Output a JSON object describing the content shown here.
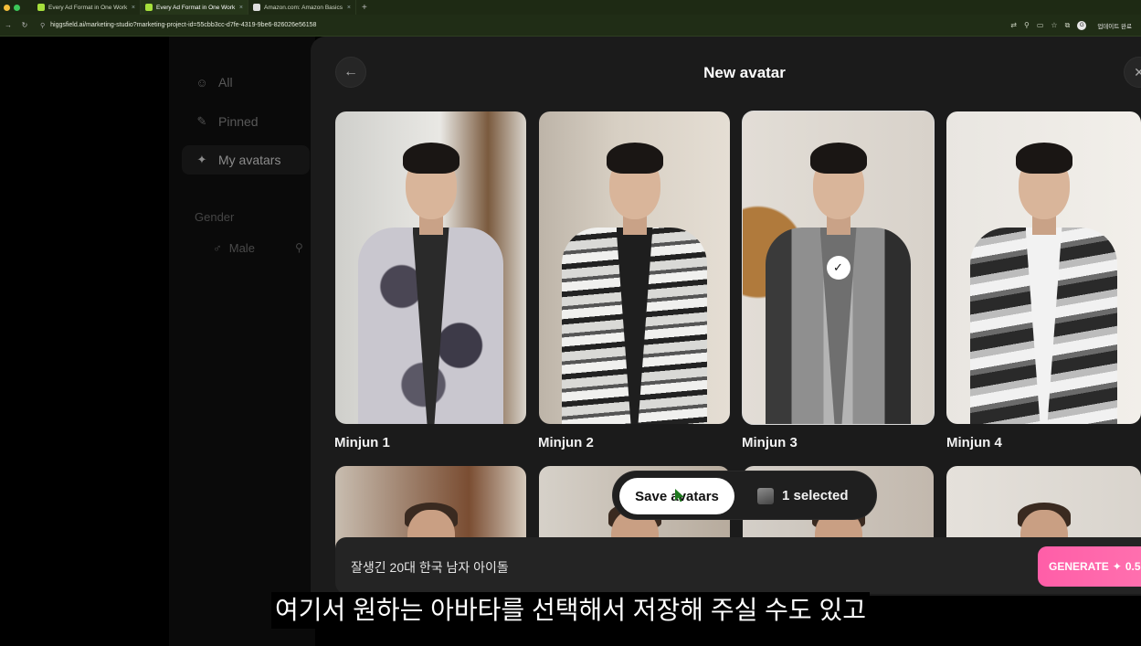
{
  "browser": {
    "tabs": [
      {
        "title": "Every Ad Format in One Work",
        "active": false
      },
      {
        "title": "Every Ad Format in One Work",
        "active": true
      },
      {
        "title": "Amazon.com: Amazon Basics",
        "active": false
      }
    ],
    "new_tab": "+",
    "url": "higgsfield.ai/marketing-studio?marketing-project-id=55cbb3cc-d7fe-4319-9be6-826026e56158",
    "update_label": "업데이트 완료",
    "profile_initial": "G"
  },
  "sidebar": {
    "items": [
      {
        "label": "All",
        "icon": "person-icon"
      },
      {
        "label": "Pinned",
        "icon": "pin-icon"
      },
      {
        "label": "My avatars",
        "icon": "sparkle-icon",
        "selected": true
      }
    ],
    "section_gender": "Gender",
    "gender_option": "Male"
  },
  "modal": {
    "title": "New avatar",
    "avatars": [
      {
        "name": "Minjun 1",
        "selected": false
      },
      {
        "name": "Minjun 2",
        "selected": false
      },
      {
        "name": "Minjun 3",
        "selected": true
      },
      {
        "name": "Minjun 4",
        "selected": false
      }
    ],
    "action_bar": {
      "save_label": "Save avatars",
      "selected_label": "1 selected"
    },
    "prompt": {
      "value": "잘생긴 20대 한국 남자 아이돌"
    },
    "generate": {
      "label": "GENERATE",
      "cost": "0.5"
    }
  },
  "subtitle": "여기서 원하는 아바타를 선택해서 저장해 주실 수도 있고",
  "colors": {
    "accent_pink": "#ff5ea8",
    "modal_bg": "#1b1b1b",
    "chrome_bg": "#1e2a14"
  }
}
